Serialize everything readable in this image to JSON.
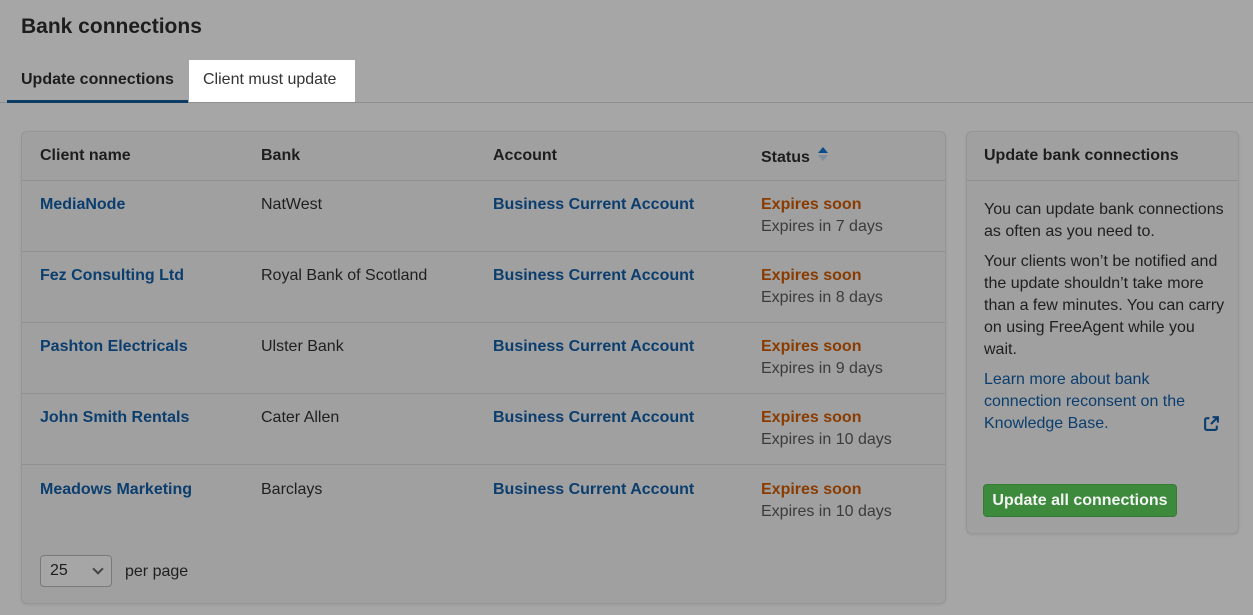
{
  "page": {
    "title": "Bank connections"
  },
  "tabs": [
    {
      "label": "Update connections",
      "active": true
    },
    {
      "label": "Client must update",
      "active": false
    }
  ],
  "table": {
    "headers": {
      "client": "Client name",
      "bank": "Bank",
      "account": "Account",
      "status": "Status"
    },
    "rows": [
      {
        "client": "MediaNode",
        "bank": "NatWest",
        "account": "Business Current Account",
        "status": "Expires soon",
        "detail": "Expires in 7 days"
      },
      {
        "client": "Fez Consulting Ltd",
        "bank": "Royal Bank of Scotland",
        "account": "Business Current Account",
        "status": "Expires soon",
        "detail": "Expires in 8 days"
      },
      {
        "client": "Pashton Electricals",
        "bank": "Ulster Bank",
        "account": "Business Current Account",
        "status": "Expires soon",
        "detail": "Expires in 9 days"
      },
      {
        "client": "John Smith Rentals",
        "bank": "Cater Allen",
        "account": "Business Current Account",
        "status": "Expires soon",
        "detail": "Expires in 10 days"
      },
      {
        "client": "Meadows Marketing",
        "bank": "Barclays",
        "account": "Business Current Account",
        "status": "Expires soon",
        "detail": "Expires in 10 days"
      }
    ],
    "pagination": {
      "per_page_value": "25",
      "per_page_label": "per page"
    }
  },
  "sidebar": {
    "title": "Update bank connections",
    "p1": "You can update bank connections as often as you need to.",
    "p2": "Your clients won’t be notified and the update shouldn’t take more than a few minutes. You can carry on using FreeAgent while you wait.",
    "link": "Learn more about bank connection reconsent on the Knowledge Base.",
    "button": "Update all connections"
  },
  "colors": {
    "link": "#0b3e6e",
    "warning": "#8a3b00",
    "primary_button": "#3d8a3d",
    "active_tab_underline": "#0c3b63"
  },
  "icons": {
    "sort": "sort-ascending-icon",
    "external": "external-link-icon",
    "select": "chevron-down-icon"
  }
}
